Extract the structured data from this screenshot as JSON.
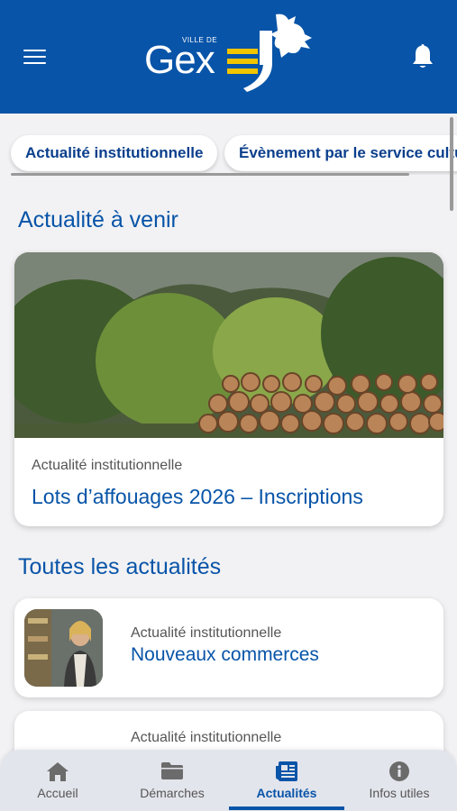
{
  "header": {
    "logo_small": "VILLE DE",
    "logo_text": "Gex",
    "colors": {
      "background": "#0854a8",
      "accent": "#f2c500"
    },
    "menu_icon": "hamburger-icon",
    "bell_icon": "bell-icon"
  },
  "filters": {
    "chips": [
      {
        "label": "Actualité institutionnelle"
      },
      {
        "label": "Évènement par le service culturel"
      }
    ]
  },
  "upcoming": {
    "title": "Actualité à venir",
    "card": {
      "category": "Actualité institutionnelle",
      "title": "Lots d’affouages 2026 – Inscriptions"
    }
  },
  "all_news": {
    "title": "Toutes les actualités",
    "items": [
      {
        "category": "Actualité institutionnelle",
        "title": "Nouveaux commerces"
      },
      {
        "category": "Actualité institutionnelle",
        "title": ""
      }
    ]
  },
  "tabbar": {
    "active": "Actualités",
    "tabs": [
      {
        "label": "Accueil",
        "icon": "home-icon"
      },
      {
        "label": "Démarches",
        "icon": "folder-icon"
      },
      {
        "label": "Actualités",
        "icon": "newspaper-icon"
      },
      {
        "label": "Infos utiles",
        "icon": "info-icon"
      }
    ]
  }
}
